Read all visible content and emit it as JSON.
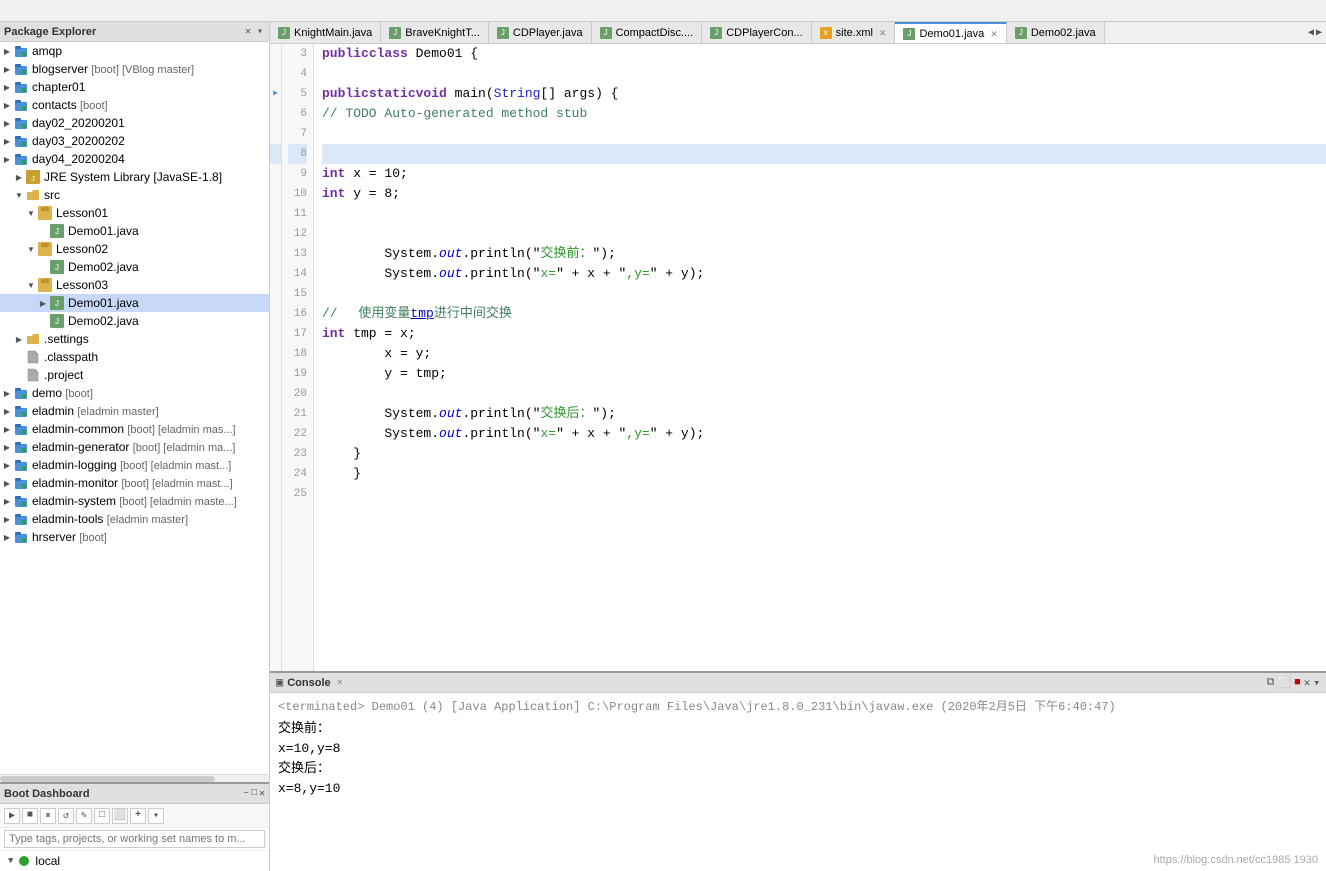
{
  "packageExplorer": {
    "title": "Package Explorer",
    "items": [
      {
        "id": "amqp",
        "label": "amqp",
        "indent": 1,
        "type": "project",
        "arrow": "▶",
        "selected": false
      },
      {
        "id": "blogserver",
        "label": "blogserver ",
        "tag": "[boot] [VBlog master]",
        "indent": 1,
        "type": "project",
        "arrow": "▶",
        "selected": false
      },
      {
        "id": "chapter01",
        "label": "chapter01",
        "indent": 1,
        "type": "project",
        "arrow": "▶",
        "selected": false
      },
      {
        "id": "contacts",
        "label": "contacts ",
        "tag": "[boot]",
        "indent": 1,
        "type": "project",
        "arrow": "▶",
        "selected": false
      },
      {
        "id": "day02",
        "label": "day02_20200201",
        "indent": 1,
        "type": "project",
        "arrow": "▶",
        "selected": false
      },
      {
        "id": "day03",
        "label": "day03_20200202",
        "indent": 1,
        "type": "project",
        "arrow": "▶",
        "selected": false
      },
      {
        "id": "day04",
        "label": "day04_20200204",
        "indent": 1,
        "type": "project",
        "arrow": "▶",
        "selected": false
      },
      {
        "id": "jre",
        "label": "JRE System Library [JavaSE-1.8]",
        "indent": 2,
        "type": "jar",
        "arrow": "▶",
        "selected": false
      },
      {
        "id": "src",
        "label": "src",
        "indent": 2,
        "type": "folder",
        "arrow": "▼",
        "selected": false
      },
      {
        "id": "lesson01",
        "label": "Lesson01",
        "indent": 3,
        "type": "package",
        "arrow": "▼",
        "selected": false
      },
      {
        "id": "demo01-1",
        "label": "Demo01.java",
        "indent": 4,
        "type": "java",
        "arrow": "",
        "selected": false
      },
      {
        "id": "lesson02",
        "label": "Lesson02",
        "indent": 3,
        "type": "package",
        "arrow": "▼",
        "selected": false
      },
      {
        "id": "demo02-1",
        "label": "Demo02.java",
        "indent": 4,
        "type": "java",
        "arrow": "",
        "selected": false
      },
      {
        "id": "lesson03",
        "label": "Lesson03",
        "indent": 3,
        "type": "package",
        "arrow": "▼",
        "selected": false
      },
      {
        "id": "demo01-3",
        "label": "Demo01.java",
        "indent": 4,
        "type": "java",
        "arrow": "▶",
        "selected": true
      },
      {
        "id": "demo02-3",
        "label": "Demo02.java",
        "indent": 4,
        "type": "java",
        "arrow": "",
        "selected": false
      },
      {
        "id": "settings",
        "label": ".settings",
        "indent": 2,
        "type": "folder",
        "arrow": "▶",
        "selected": false
      },
      {
        "id": "classpath",
        "label": ".classpath",
        "indent": 2,
        "type": "file",
        "arrow": "",
        "selected": false
      },
      {
        "id": "project",
        "label": ".project",
        "indent": 2,
        "type": "file",
        "arrow": "",
        "selected": false
      },
      {
        "id": "demo",
        "label": "demo ",
        "tag": "[boot]",
        "indent": 1,
        "type": "project",
        "arrow": "▶",
        "selected": false
      },
      {
        "id": "eladmin",
        "label": "eladmin ",
        "tag": "[eladmin master]",
        "indent": 1,
        "type": "project",
        "arrow": "▶",
        "selected": false
      },
      {
        "id": "eladmin-common",
        "label": "eladmin-common ",
        "tag": "[boot] [eladmin mas...]",
        "indent": 1,
        "type": "project",
        "arrow": "▶",
        "selected": false
      },
      {
        "id": "eladmin-generator",
        "label": "eladmin-generator ",
        "tag": "[boot] [eladmin ma...]",
        "indent": 1,
        "type": "project",
        "arrow": "▶",
        "selected": false
      },
      {
        "id": "eladmin-logging",
        "label": "eladmin-logging ",
        "tag": "[boot] [eladmin mast...]",
        "indent": 1,
        "type": "project",
        "arrow": "▶",
        "selected": false
      },
      {
        "id": "eladmin-monitor",
        "label": "eladmin-monitor ",
        "tag": "[boot] [eladmin mast...]",
        "indent": 1,
        "type": "project",
        "arrow": "▶",
        "selected": false
      },
      {
        "id": "eladmin-system",
        "label": "eladmin-system ",
        "tag": "[boot] [eladmin maste...]",
        "indent": 1,
        "type": "project",
        "arrow": "▶",
        "selected": false
      },
      {
        "id": "eladmin-tools",
        "label": "eladmin-tools ",
        "tag": "[eladmin master]",
        "indent": 1,
        "type": "project",
        "arrow": "▶",
        "selected": false
      },
      {
        "id": "hrserver",
        "label": "hrserver ",
        "tag": "[boot]",
        "indent": 1,
        "type": "project",
        "arrow": "▶",
        "selected": false
      }
    ]
  },
  "tabs": [
    {
      "label": "KnightMain.java",
      "active": false,
      "type": "java"
    },
    {
      "label": "BraveKnightT...",
      "active": false,
      "type": "java"
    },
    {
      "label": "CDPlayer.java",
      "active": false,
      "type": "java"
    },
    {
      "label": "CompactDisc....",
      "active": false,
      "type": "java"
    },
    {
      "label": "CDPlayerCon...",
      "active": false,
      "type": "java"
    },
    {
      "label": "site.xml",
      "active": false,
      "type": "xml",
      "closeable": true
    },
    {
      "label": "Demo01.java",
      "active": true,
      "type": "java"
    },
    {
      "label": "Demo02.java",
      "active": false,
      "type": "java"
    }
  ],
  "codeLines": [
    {
      "num": 3,
      "content": "public class Demo01 {",
      "highlighted": false,
      "gutter": ""
    },
    {
      "num": 4,
      "content": "",
      "highlighted": false,
      "gutter": ""
    },
    {
      "num": 5,
      "content": "    public static void main(String[] args) {",
      "highlighted": false,
      "gutter": "arrow"
    },
    {
      "num": 6,
      "content": "        // TODO Auto-generated method stub",
      "highlighted": false,
      "gutter": ""
    },
    {
      "num": 7,
      "content": "",
      "highlighted": false,
      "gutter": ""
    },
    {
      "num": 8,
      "content": "",
      "highlighted": true,
      "gutter": ""
    },
    {
      "num": 9,
      "content": "        int x = 10;",
      "highlighted": false,
      "gutter": ""
    },
    {
      "num": 10,
      "content": "        int y = 8;",
      "highlighted": false,
      "gutter": ""
    },
    {
      "num": 11,
      "content": "",
      "highlighted": false,
      "gutter": ""
    },
    {
      "num": 12,
      "content": "",
      "highlighted": false,
      "gutter": ""
    },
    {
      "num": 13,
      "content": "        System.out.println(\"交换前：\");",
      "highlighted": false,
      "gutter": ""
    },
    {
      "num": 14,
      "content": "        System.out.println(\"x=\" + x + \",y=\" + y);",
      "highlighted": false,
      "gutter": ""
    },
    {
      "num": 15,
      "content": "",
      "highlighted": false,
      "gutter": ""
    },
    {
      "num": 16,
      "content": "        //  使用变量tmp进行中间交换",
      "highlighted": false,
      "gutter": ""
    },
    {
      "num": 17,
      "content": "        int tmp = x;",
      "highlighted": false,
      "gutter": ""
    },
    {
      "num": 18,
      "content": "        x = y;",
      "highlighted": false,
      "gutter": ""
    },
    {
      "num": 19,
      "content": "        y = tmp;",
      "highlighted": false,
      "gutter": ""
    },
    {
      "num": 20,
      "content": "",
      "highlighted": false,
      "gutter": ""
    },
    {
      "num": 21,
      "content": "        System.out.println(\"交换后：\");",
      "highlighted": false,
      "gutter": ""
    },
    {
      "num": 22,
      "content": "        System.out.println(\"x=\" + x + \",y=\" + y);",
      "highlighted": false,
      "gutter": ""
    },
    {
      "num": 23,
      "content": "    }",
      "highlighted": false,
      "gutter": ""
    },
    {
      "num": 24,
      "content": "}",
      "highlighted": false,
      "gutter": ""
    },
    {
      "num": 25,
      "content": "",
      "highlighted": false,
      "gutter": ""
    }
  ],
  "bootDashboard": {
    "title": "Boot Dashboard",
    "searchPlaceholder": "Type tags, projects, or working set names to m...",
    "localLabel": "local",
    "toolbarButtons": [
      "▶",
      "⏹",
      "⏸",
      "🔄",
      "✏",
      "□",
      "⬜",
      "➕",
      "▾"
    ]
  },
  "console": {
    "title": "Console",
    "terminatedText": "<terminated> Demo01 (4) [Java Application] C:\\Program Files\\Java\\jre1.8.0_231\\bin\\javaw.exe (2020年2月5日 下午6:40:47)",
    "output": [
      "交换前：",
      "x=10,y=8",
      "交换后：",
      "x=8,y=10"
    ]
  },
  "watermark": "https://blog.csdn.net/cc1985 1930"
}
